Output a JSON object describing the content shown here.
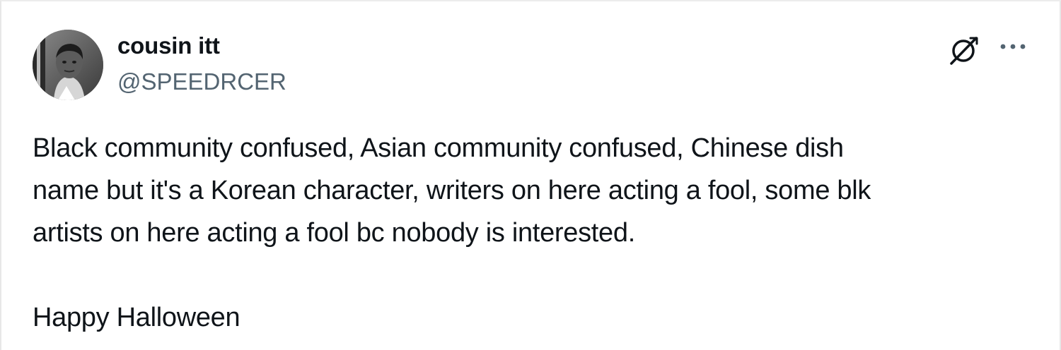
{
  "author": {
    "display_name": "cousin itt",
    "handle": "@SPEEDRCER",
    "avatar_icon": "avatar-photo"
  },
  "actions": {
    "grok_icon": "grok-icon",
    "more_icon": "more-options-icon"
  },
  "tweet": {
    "text": "Black community confused, Asian community confused, Chinese dish\nname but it's a Korean character, writers on here acting a fool, some blk\nartists on here acting a fool bc nobody is interested.\n\nHappy Halloween"
  },
  "colors": {
    "text_primary": "#0f1419",
    "text_secondary": "#536471",
    "border": "#e7e7e7"
  }
}
